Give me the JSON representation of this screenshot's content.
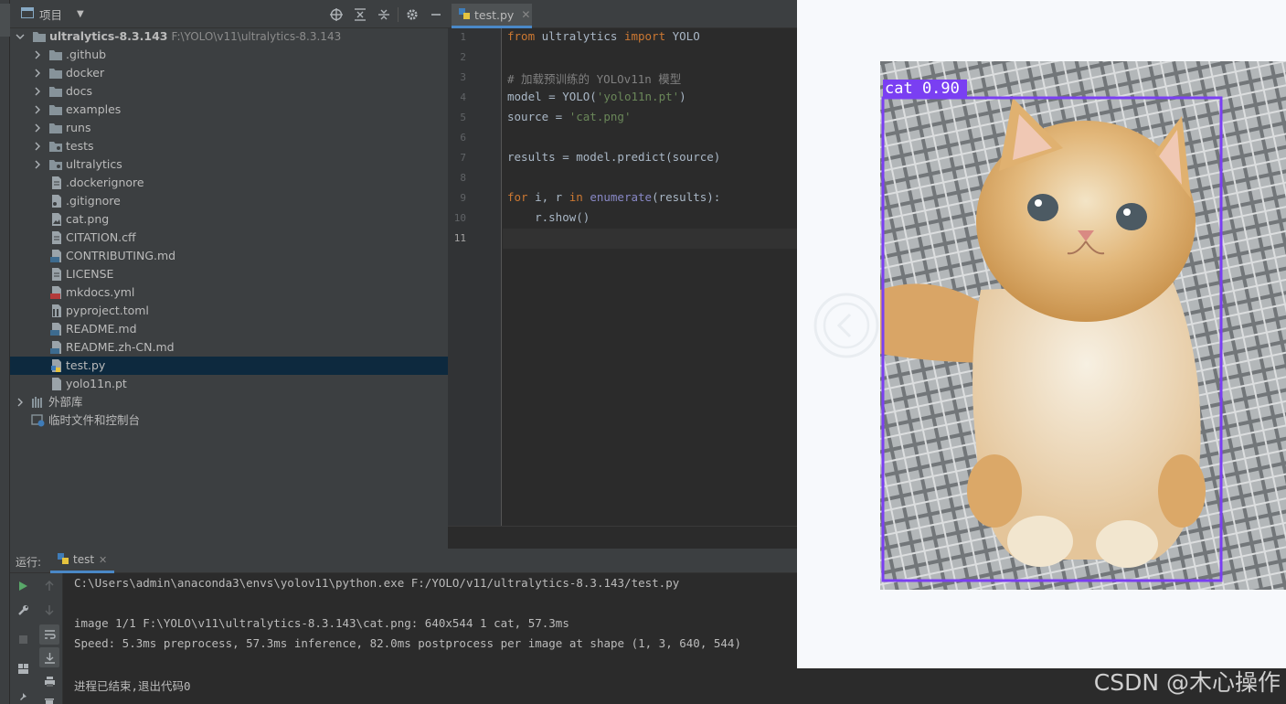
{
  "project": {
    "panel_title": "项目",
    "root_name": "ultralytics-8.3.143",
    "root_path": "F:\\YOLO\\v11\\ultralytics-8.3.143",
    "tree": [
      {
        "label": "ultralytics-8.3.143",
        "kind": "root"
      },
      {
        "label": ".github",
        "kind": "folder"
      },
      {
        "label": "docker",
        "kind": "folder"
      },
      {
        "label": "docs",
        "kind": "folder"
      },
      {
        "label": "examples",
        "kind": "folder"
      },
      {
        "label": "runs",
        "kind": "folder"
      },
      {
        "label": "tests",
        "kind": "folder-pkg"
      },
      {
        "label": "ultralytics",
        "kind": "folder-pkg"
      },
      {
        "label": ".dockerignore",
        "kind": "file"
      },
      {
        "label": ".gitignore",
        "kind": "file"
      },
      {
        "label": "cat.png",
        "kind": "image"
      },
      {
        "label": "CITATION.cff",
        "kind": "file"
      },
      {
        "label": "CONTRIBUTING.md",
        "kind": "md"
      },
      {
        "label": "LICENSE",
        "kind": "file"
      },
      {
        "label": "mkdocs.yml",
        "kind": "yml"
      },
      {
        "label": "pyproject.toml",
        "kind": "toml"
      },
      {
        "label": "README.md",
        "kind": "md"
      },
      {
        "label": "README.zh-CN.md",
        "kind": "md"
      },
      {
        "label": "test.py",
        "kind": "python"
      },
      {
        "label": "yolo11n.pt",
        "kind": "file"
      },
      {
        "label": "外部库",
        "kind": "library"
      },
      {
        "label": "临时文件和控制台",
        "kind": "scratch"
      }
    ],
    "selected": "test.py"
  },
  "editor": {
    "tab_label": "test.py",
    "line_numbers": [
      "1",
      "2",
      "3",
      "4",
      "5",
      "6",
      "7",
      "8",
      "9",
      "10",
      "11"
    ],
    "current_line": 11,
    "code": {
      "l1_kw1": "from",
      "l1_mod": " ultralytics ",
      "l1_kw2": "import",
      "l1_name": " YOLO",
      "l3_comment": "# 加载预训练的 YOLOv11n 模型",
      "l4_a": "model = YOLO(",
      "l4_str": "'yolo11n.pt'",
      "l4_b": ")",
      "l5_a": "source = ",
      "l5_str": "'cat.png'",
      "l7": "results = model.predict(source)",
      "l9_kw1": "for",
      "l9_a": " i, r ",
      "l9_kw2": "in",
      "l9_sp": " ",
      "l9_bi": "enumerate",
      "l9_b": "(results):",
      "l10": "    r.show()"
    }
  },
  "run": {
    "label": "运行:",
    "tab_label": "test",
    "console_lines": [
      "C:\\Users\\admin\\anaconda3\\envs\\yolov11\\python.exe F:/YOLO/v11/ultralytics-8.3.143/test.py",
      "",
      "image 1/1 F:\\YOLO\\v11\\ultralytics-8.3.143\\cat.png: 640x544 1 cat, 57.3ms",
      "Speed: 5.3ms preprocess, 57.3ms inference, 82.0ms postprocess per image at shape (1, 3, 640, 544)",
      "",
      "进程已结束,退出代码0"
    ]
  },
  "viewer": {
    "detection_label": "cat 0.90",
    "box_color": "#7a3ff2"
  },
  "watermark": "CSDN @木心操作"
}
